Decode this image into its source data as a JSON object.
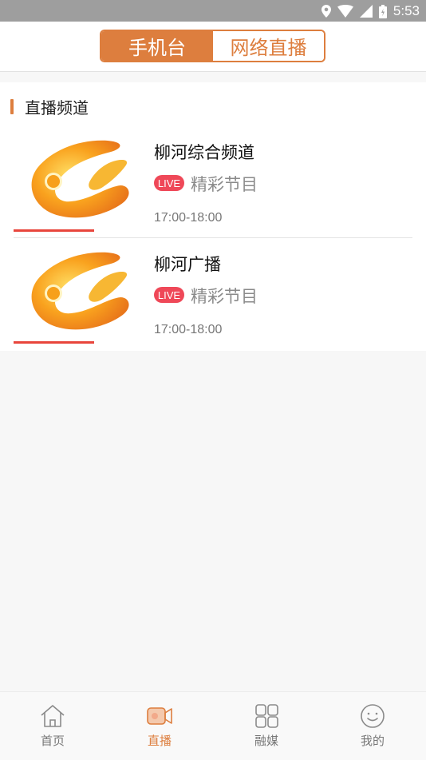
{
  "status_bar": {
    "time": "5:53"
  },
  "tabs": [
    {
      "label": "手机台",
      "active": true
    },
    {
      "label": "网络直播",
      "active": false
    }
  ],
  "section": {
    "title": "直播频道"
  },
  "channels": [
    {
      "name": "柳河综合频道",
      "badge": "LIVE",
      "program": "精彩节目",
      "time": "17:00-18:00"
    },
    {
      "name": "柳河广播",
      "badge": "LIVE",
      "program": "精彩节目",
      "time": "17:00-18:00"
    }
  ],
  "bottom_nav": [
    {
      "label": "首页",
      "icon": "home-icon",
      "active": false
    },
    {
      "label": "直播",
      "icon": "video-camera-icon",
      "active": true
    },
    {
      "label": "融媒",
      "icon": "grid-icon",
      "active": false
    },
    {
      "label": "我的",
      "icon": "smiley-icon",
      "active": false
    }
  ],
  "colors": {
    "accent": "#dd7e3e",
    "live": "#ef4858",
    "thumb_line": "#e8453c"
  }
}
